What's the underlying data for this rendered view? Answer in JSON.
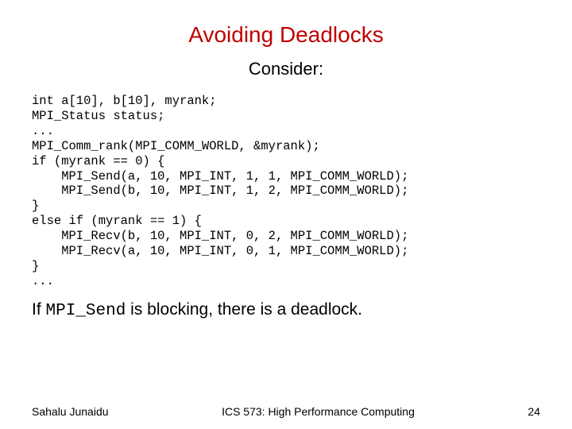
{
  "title": "Avoiding Deadlocks",
  "subtitle": "Consider:",
  "code": "int a[10], b[10], myrank;\nMPI_Status status;\n...\nMPI_Comm_rank(MPI_COMM_WORLD, &myrank);\nif (myrank == 0) {\n    MPI_Send(a, 10, MPI_INT, 1, 1, MPI_COMM_WORLD);\n    MPI_Send(b, 10, MPI_INT, 1, 2, MPI_COMM_WORLD);\n}\nelse if (myrank == 1) {\n    MPI_Recv(b, 10, MPI_INT, 0, 2, MPI_COMM_WORLD);\n    MPI_Recv(a, 10, MPI_INT, 0, 1, MPI_COMM_WORLD);\n}\n...",
  "note_prefix": "If ",
  "note_code": "MPI_Send",
  "note_suffix": " is blocking, there is a deadlock.",
  "footer": {
    "left": "Sahalu Junaidu",
    "center": "ICS 573: High Performance Computing",
    "right": "24"
  }
}
